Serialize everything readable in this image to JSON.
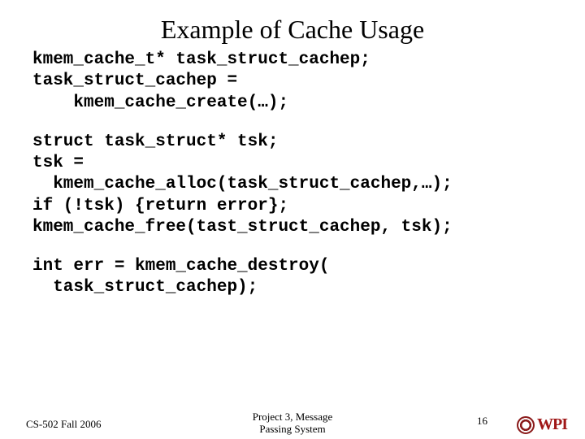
{
  "title": "Example of Cache Usage",
  "code": {
    "block1": "kmem_cache_t* task_struct_cachep;\ntask_struct_cachep =\n    kmem_cache_create(…);",
    "block2": "struct task_struct* tsk;\ntsk =\n  kmem_cache_alloc(task_struct_cachep,…);\nif (!tsk) {return error};\nkmem_cache_free(tast_struct_cachep, tsk);",
    "block3": "int err = kmem_cache_destroy(\n  task_struct_cachep);"
  },
  "footer": {
    "left": "CS-502 Fall 2006",
    "center": "Project 3, Message\nPassing System",
    "page": "16",
    "logo_text": "WPI"
  }
}
